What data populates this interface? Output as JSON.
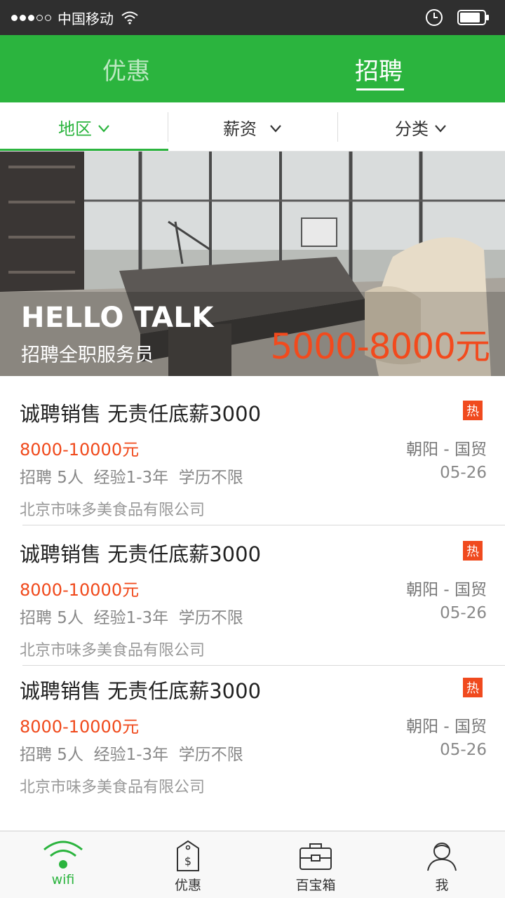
{
  "status_bar": {
    "carrier": "中国移动"
  },
  "top_tabs": [
    {
      "label": "优惠"
    },
    {
      "label": "招聘"
    }
  ],
  "filters": [
    {
      "label": "地区"
    },
    {
      "label": "薪资"
    },
    {
      "label": "分类"
    }
  ],
  "banner": {
    "title": "HELLO TALK",
    "subtitle": "招聘全职服务员",
    "salary": "5000-8000元"
  },
  "jobs": [
    {
      "title": "诚聘销售 无责任底薪3000",
      "badge": "热",
      "salary": "8000-10000元",
      "location": "朝阳 - 国贸",
      "meta": "招聘 5人  经验1-3年  学历不限",
      "date": "05-26",
      "company": "北京市味多美食品有限公司"
    },
    {
      "title": "诚聘销售 无责任底薪3000",
      "badge": "热",
      "salary": "8000-10000元",
      "location": "朝阳 - 国贸",
      "meta": "招聘 5人  经验1-3年  学历不限",
      "date": "05-26",
      "company": "北京市味多美食品有限公司"
    },
    {
      "title": "诚聘销售 无责任底薪3000",
      "badge": "热",
      "salary": "8000-10000元",
      "location": "朝阳 - 国贸",
      "meta": "招聘 5人  经验1-3年  学历不限",
      "date": "05-26",
      "company": "北京市味多美食品有限公司"
    }
  ],
  "bottom_nav": [
    {
      "label": "wifi",
      "icon": "wifi-icon"
    },
    {
      "label": "优惠",
      "icon": "price-tag-icon"
    },
    {
      "label": "百宝箱",
      "icon": "toolbox-icon"
    },
    {
      "label": "我",
      "icon": "user-icon"
    }
  ],
  "colors": {
    "brand_green": "#2bb43e",
    "accent_orange": "#f0491b",
    "status_bar": "#2f2f2f"
  }
}
